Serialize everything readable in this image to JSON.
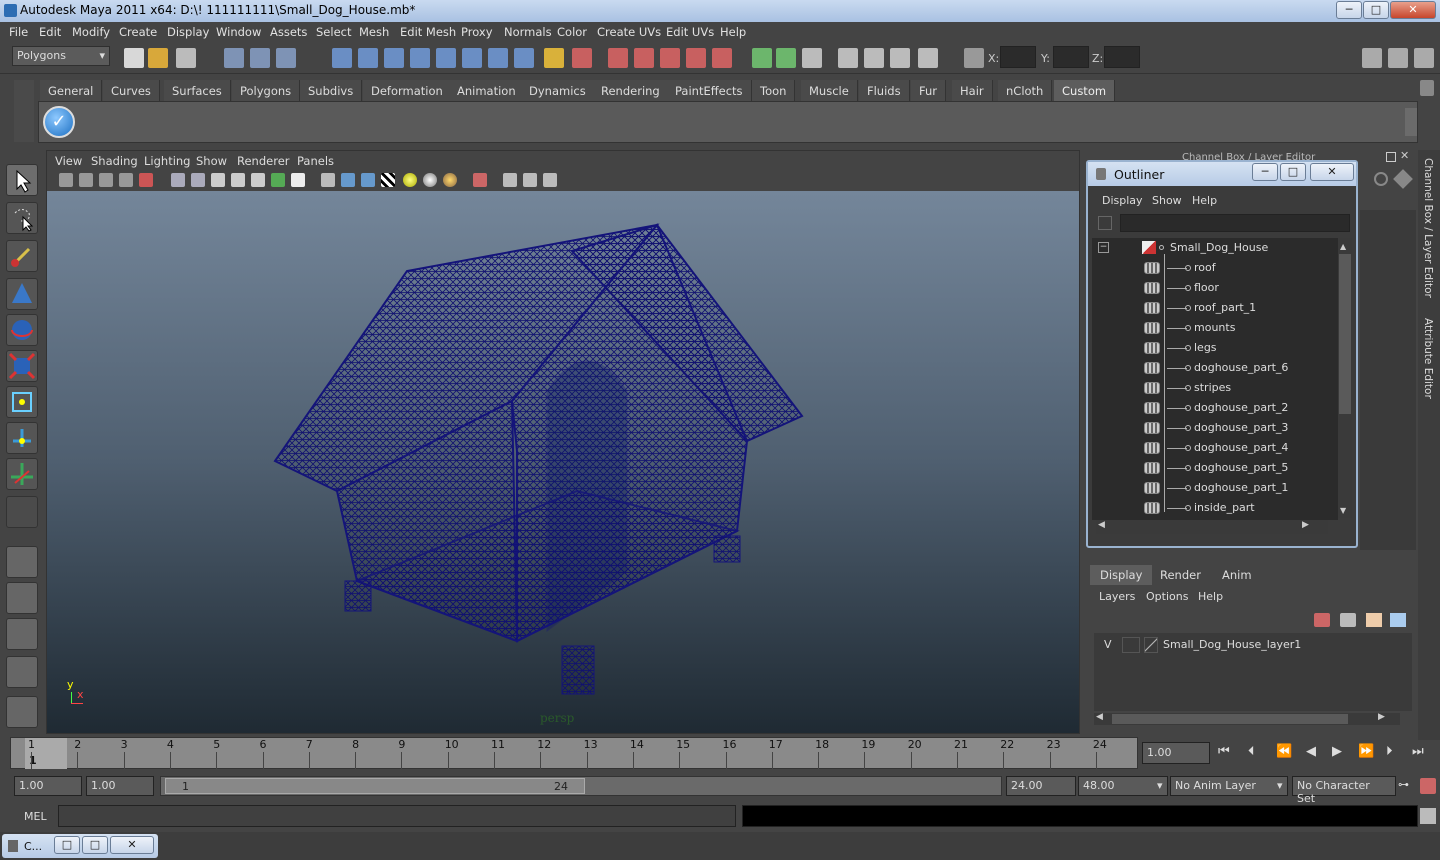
{
  "title": "Autodesk Maya 2011 x64: D:\\! 111111111\\Small_Dog_House.mb*",
  "window_controls": {
    "minimize": "─",
    "maximize": "□",
    "close": "✕"
  },
  "menu": [
    "File",
    "Edit",
    "Modify",
    "Create",
    "Display",
    "Window",
    "Assets",
    "Select",
    "Mesh",
    "Edit Mesh",
    "Proxy",
    "Normals",
    "Color",
    "Create UVs",
    "Edit UVs",
    "Help"
  ],
  "menu_mode": "Polygons",
  "coords": {
    "x_label": "X:",
    "y_label": "Y:",
    "z_label": "Z:"
  },
  "shelf_tabs": [
    "General",
    "Curves",
    "Surfaces",
    "Polygons",
    "Subdivs",
    "Deformation",
    "Animation",
    "Dynamics",
    "Rendering",
    "PaintEffects",
    "Toon",
    "Muscle",
    "Fluids",
    "Fur",
    "Hair",
    "nCloth",
    "Custom"
  ],
  "shelf_active": "Custom",
  "viewport_menu": [
    "View",
    "Shading",
    "Lighting",
    "Show",
    "Renderer",
    "Panels"
  ],
  "viewport_camera": "persp",
  "axis": {
    "x": "x",
    "y": "y"
  },
  "channel_box_title": "Channel Box / Layer Editor",
  "side_tabs": {
    "channel": "Channel Box / Layer Editor",
    "attribute": "Attribute Editor"
  },
  "outliner": {
    "title": "Outliner",
    "menu": [
      "Display",
      "Show",
      "Help"
    ],
    "root": "Small_Dog_House",
    "items": [
      "roof",
      "floor",
      "roof_part_1",
      "mounts",
      "legs",
      "doghouse_part_6",
      "stripes",
      "doghouse_part_2",
      "doghouse_part_3",
      "doghouse_part_4",
      "doghouse_part_5",
      "doghouse_part_1",
      "inside_part"
    ]
  },
  "layers": {
    "tabs": [
      "Display",
      "Render",
      "Anim"
    ],
    "active_tab": "Display",
    "menu": [
      "Layers",
      "Options",
      "Help"
    ],
    "rows": [
      {
        "visible": "V",
        "name": "Small_Dog_House_layer1"
      }
    ]
  },
  "timeline": {
    "ticks": [
      "1",
      "2",
      "3",
      "4",
      "5",
      "6",
      "7",
      "8",
      "9",
      "10",
      "11",
      "12",
      "13",
      "14",
      "15",
      "16",
      "17",
      "18",
      "19",
      "20",
      "21",
      "22",
      "23",
      "24"
    ],
    "current_marker": "1",
    "current_time": "1.00"
  },
  "range": {
    "start": "1.00",
    "start2": "1.00",
    "slider_start": "1",
    "slider_end": "24",
    "end": "24.00",
    "end2": "48.00",
    "anim_layer": "No Anim Layer",
    "character_set": "No Character Set"
  },
  "mel_label": "MEL",
  "taskbar_item": "C..."
}
